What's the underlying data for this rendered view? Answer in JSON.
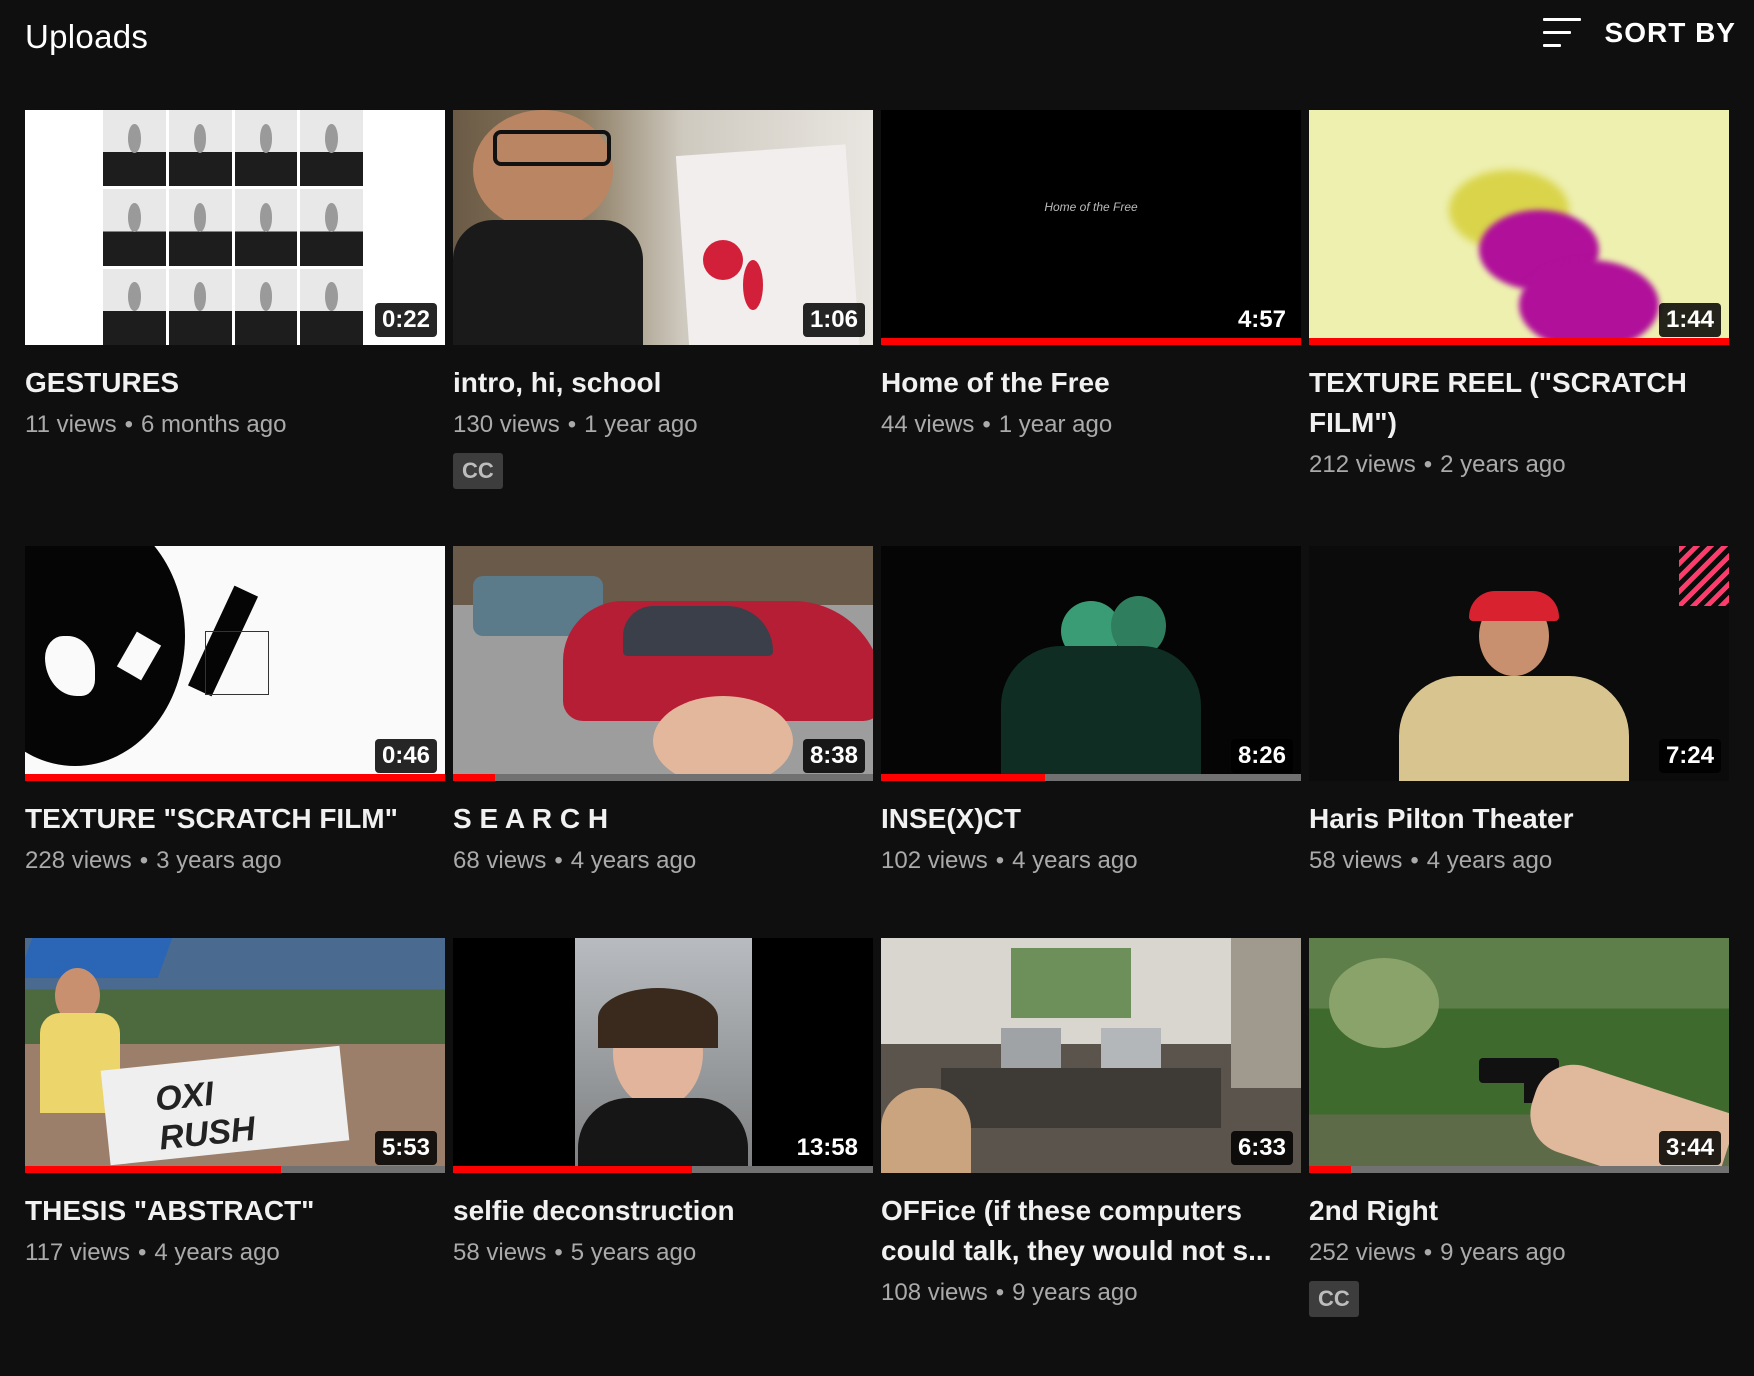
{
  "header": {
    "title": "Uploads",
    "sort_label": "SORT BY",
    "sort_icon": "sort-lines-icon"
  },
  "videos": [
    {
      "title": "GESTURES",
      "views": "11 views",
      "age": "6 months ago",
      "duration": "0:22",
      "watched": 0,
      "cc": false
    },
    {
      "title": "intro, hi, school",
      "views": "130 views",
      "age": "1 year ago",
      "duration": "1:06",
      "watched": 0,
      "cc": true
    },
    {
      "title": "Home of the Free",
      "views": "44 views",
      "age": "1 year ago",
      "duration": "4:57",
      "watched": 1,
      "cc": false,
      "thumb_text": "Home of the Free"
    },
    {
      "title": "TEXTURE REEL (\"SCRATCH FILM\")",
      "views": "212 views",
      "age": "2 years ago",
      "duration": "1:44",
      "watched": 1,
      "cc": false
    },
    {
      "title": "TEXTURE \"SCRATCH FILM\"",
      "views": "228 views",
      "age": "3 years ago",
      "duration": "0:46",
      "watched": 1,
      "cc": false
    },
    {
      "title": "S E A R C H",
      "views": "68 views",
      "age": "4 years ago",
      "duration": "8:38",
      "watched": 0.1,
      "cc": false
    },
    {
      "title": "INSE(X)CT",
      "views": "102 views",
      "age": "4 years ago",
      "duration": "8:26",
      "watched": 0.39,
      "cc": false
    },
    {
      "title": "Haris Pilton Theater",
      "views": "58 views",
      "age": "4 years ago",
      "duration": "7:24",
      "watched": 0,
      "cc": false
    },
    {
      "title": "THESIS \"ABSTRACT\"",
      "views": "117 views",
      "age": "4 years ago",
      "duration": "5:53",
      "watched": 0.61,
      "cc": false
    },
    {
      "title": "selfie deconstruction",
      "views": "58 views",
      "age": "5 years ago",
      "duration": "13:58",
      "watched": 0.57,
      "cc": false
    },
    {
      "title": "OFFice (if these computers could talk, they would not s...",
      "views": "108 views",
      "age": "9 years ago",
      "duration": "6:33",
      "watched": 0,
      "cc": false
    },
    {
      "title": "2nd Right",
      "views": "252 views",
      "age": "9 years ago",
      "duration": "3:44",
      "watched": 0.1,
      "cc": true
    }
  ],
  "cc_label": "CC",
  "meta_separator": "•",
  "colors": {
    "background": "#0f0f0f",
    "progress_red": "#ff0000",
    "progress_track": "#717171",
    "meta_gray": "#aaaaaa"
  }
}
